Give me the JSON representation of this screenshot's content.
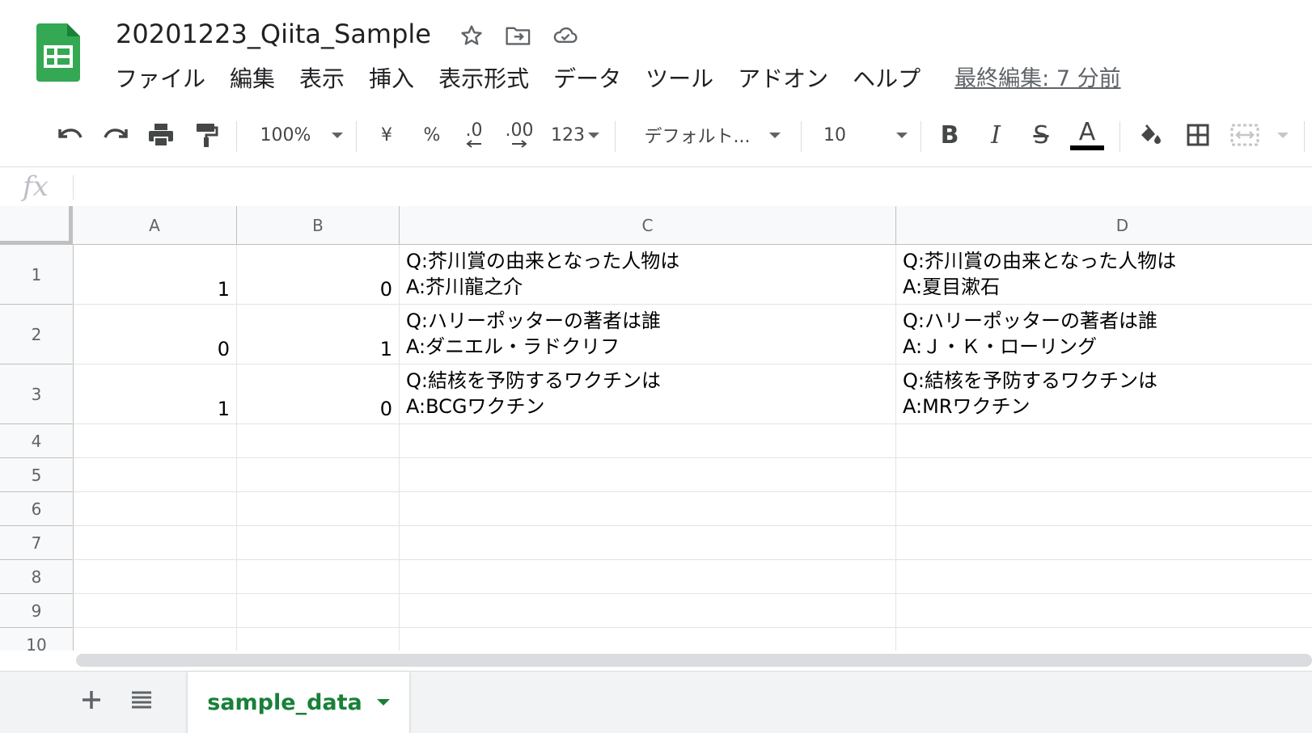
{
  "doc": {
    "title": "20201223_Qiita_Sample"
  },
  "menu": [
    "ファイル",
    "編集",
    "表示",
    "挿入",
    "表示形式",
    "データ",
    "ツール",
    "アドオン",
    "ヘルプ"
  ],
  "last_edit": "最終編集: 7 分前",
  "toolbar": {
    "zoom": "100%",
    "currency": "¥",
    "percent": "%",
    "decrease_decimals": ".0",
    "increase_decimals": ".00",
    "more_formats": "123",
    "font": "デフォルト...",
    "font_size": "10",
    "text_color": "#000000"
  },
  "formula_bar": {
    "fx_label": "fx",
    "content": ""
  },
  "columns": [
    "A",
    "B",
    "C",
    "D"
  ],
  "rows": [
    "1",
    "2",
    "3",
    "4",
    "5",
    "6",
    "7",
    "8",
    "9",
    "10"
  ],
  "cells": [
    {
      "A": "1",
      "B": "0",
      "C": "Q:芥川賞の由来となった人物は\nA:芥川龍之介",
      "D": "Q:芥川賞の由来となった人物は\nA:夏目漱石"
    },
    {
      "A": "0",
      "B": "1",
      "C": "Q:ハリーポッターの著者は誰\nA:ダニエル・ラドクリフ",
      "D": "Q:ハリーポッターの著者は誰\nA:Ｊ・Ｋ・ローリング"
    },
    {
      "A": "1",
      "B": "0",
      "C": "Q:結核を予防するワクチンは\nA:BCGワクチン",
      "D": "Q:結核を予防するワクチンは\nA:MRワクチン"
    }
  ],
  "sheets": [
    {
      "name": "sample_data",
      "active": true
    }
  ],
  "colors": {
    "accent_green": "#188038",
    "logo_green": "#34a853",
    "grid_line": "#e2e3e3",
    "header_bg": "#f8f9fa"
  }
}
